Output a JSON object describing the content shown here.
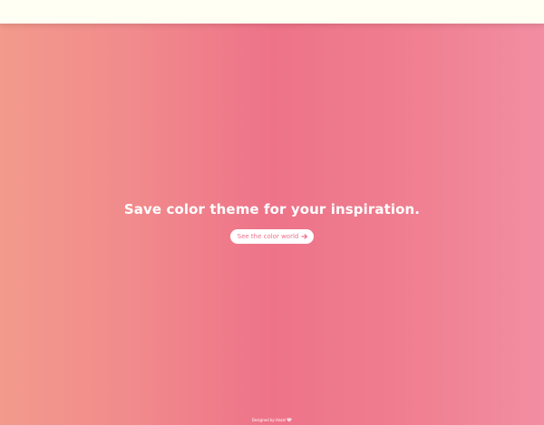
{
  "header": {
    "background_color": "#fffff4"
  },
  "hero": {
    "title": "Save color theme for your inspiration.",
    "cta_label": "See the color world",
    "cta_icon": "arrow-right-icon"
  },
  "footer": {
    "credit": "Designed by Hazel",
    "credit_icon": "gem-icon"
  },
  "colors": {
    "gradient_start": "#f39a8c",
    "gradient_middle": "#ee7389",
    "gradient_end": "#f28ea1",
    "button_background": "#ffffff",
    "button_text": "#ef6f89",
    "text": "#ffffff"
  }
}
